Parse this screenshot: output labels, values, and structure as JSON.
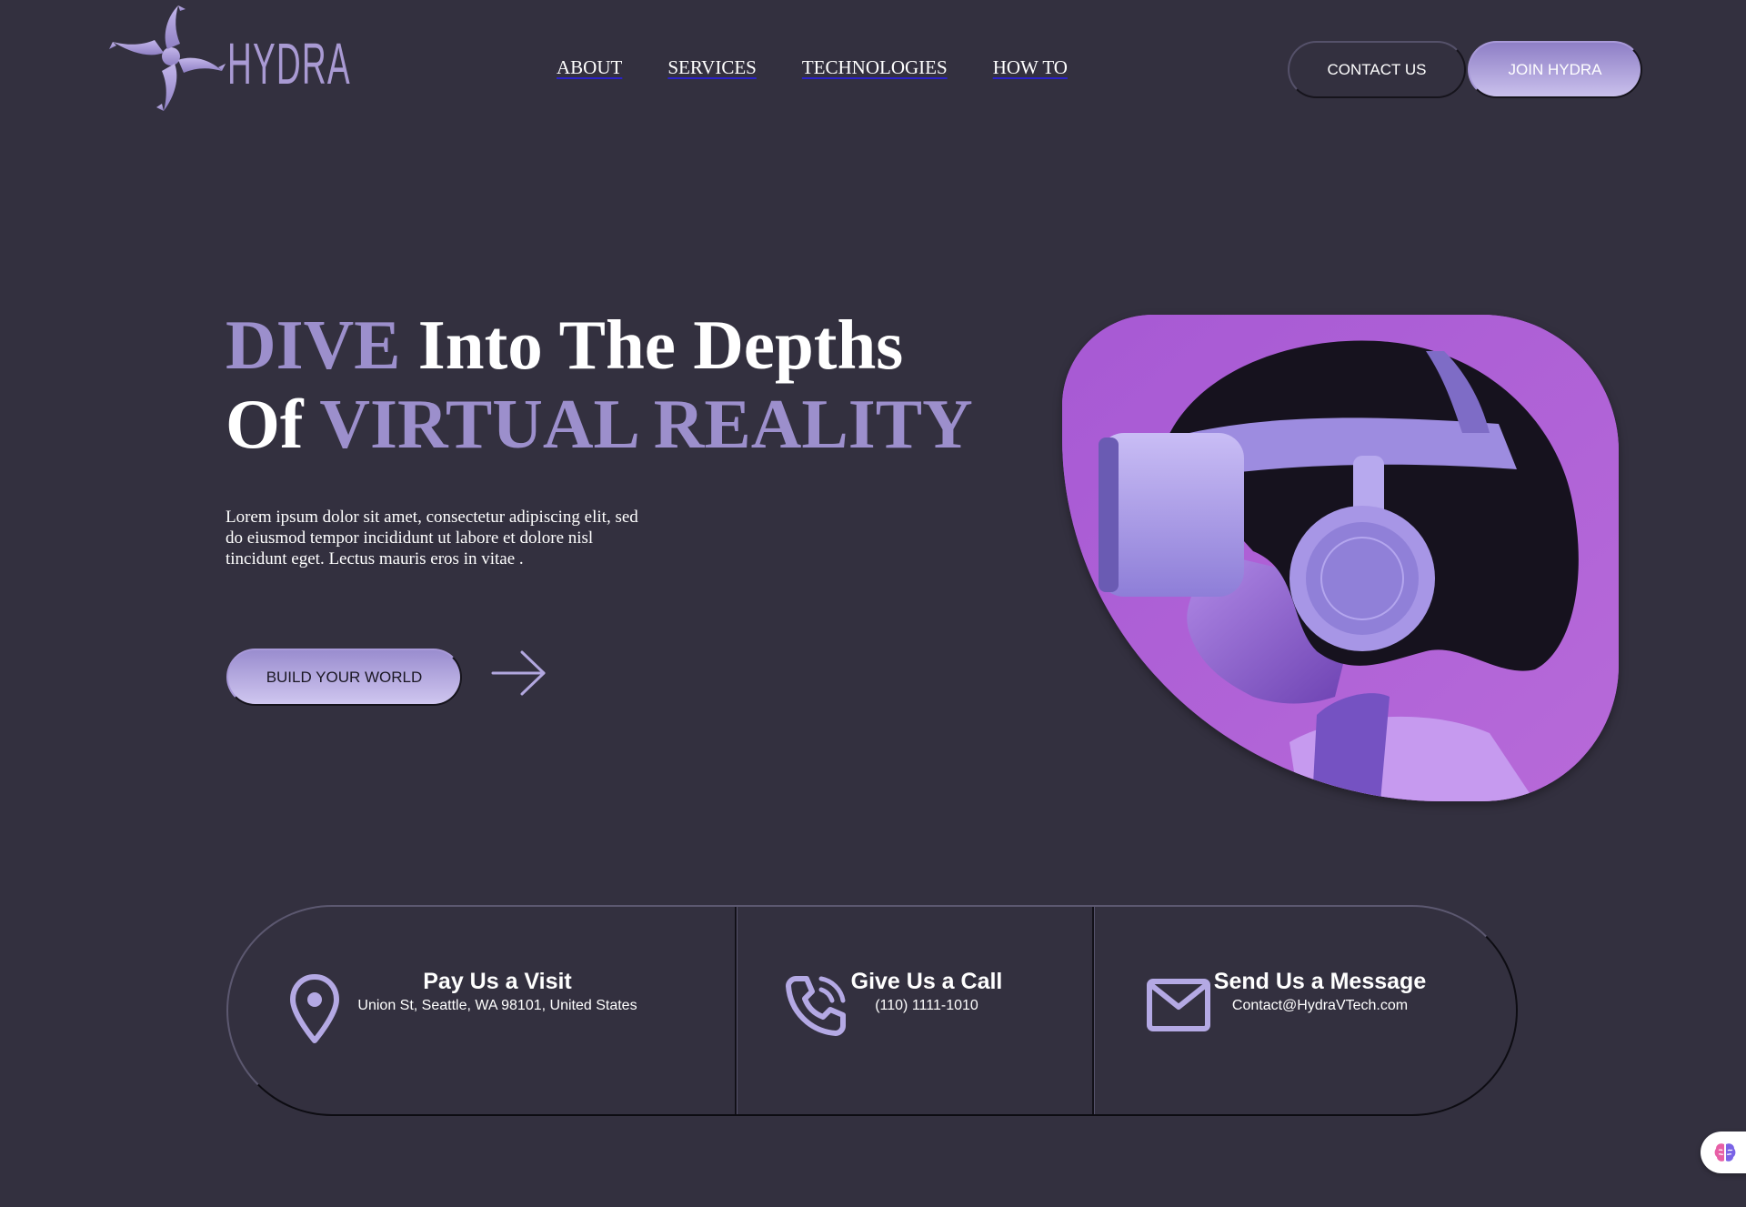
{
  "brand": {
    "name": "HYDRA"
  },
  "nav": {
    "items": [
      {
        "label": "ABOUT"
      },
      {
        "label": "SERVICES"
      },
      {
        "label": "TECHNOLOGIES"
      },
      {
        "label": "HOW TO"
      }
    ]
  },
  "header": {
    "contact_label": "CONTACT US",
    "join_label": "JOIN HYDRA"
  },
  "hero": {
    "title_word_1": "DIVE",
    "title_part_2": " Into The Depths",
    "title_part_3": "Of ",
    "title_word_4": "VIRTUAL REALITY",
    "description": "Lorem ipsum dolor sit amet, consectetur adipiscing elit, sed do eiusmod tempor incididunt ut labore et dolore nisl tincidunt eget. Lectus mauris eros in vitae .",
    "cta_label": "BUILD YOUR WORLD",
    "arrow_icon": "arrow-right-icon"
  },
  "contact": {
    "items": [
      {
        "icon": "map-pin-icon",
        "title": "Pay Us a Visit",
        "detail": "Union St, Seattle, WA 98101, United States"
      },
      {
        "icon": "phone-icon",
        "title": "Give Us a Call",
        "detail": "(110) 1111-1010"
      },
      {
        "icon": "mail-icon",
        "title": "Send Us a Message",
        "detail": "Contact@HydraVTech.com"
      }
    ]
  },
  "colors": {
    "background": "#33303f",
    "accent": "#9c8fcc",
    "button_gradient_top": "#8e7fc6",
    "button_gradient_bottom": "#c9c0ec",
    "image_purple": "#b05fd6"
  },
  "widget": {
    "icon": "brain-icon"
  }
}
